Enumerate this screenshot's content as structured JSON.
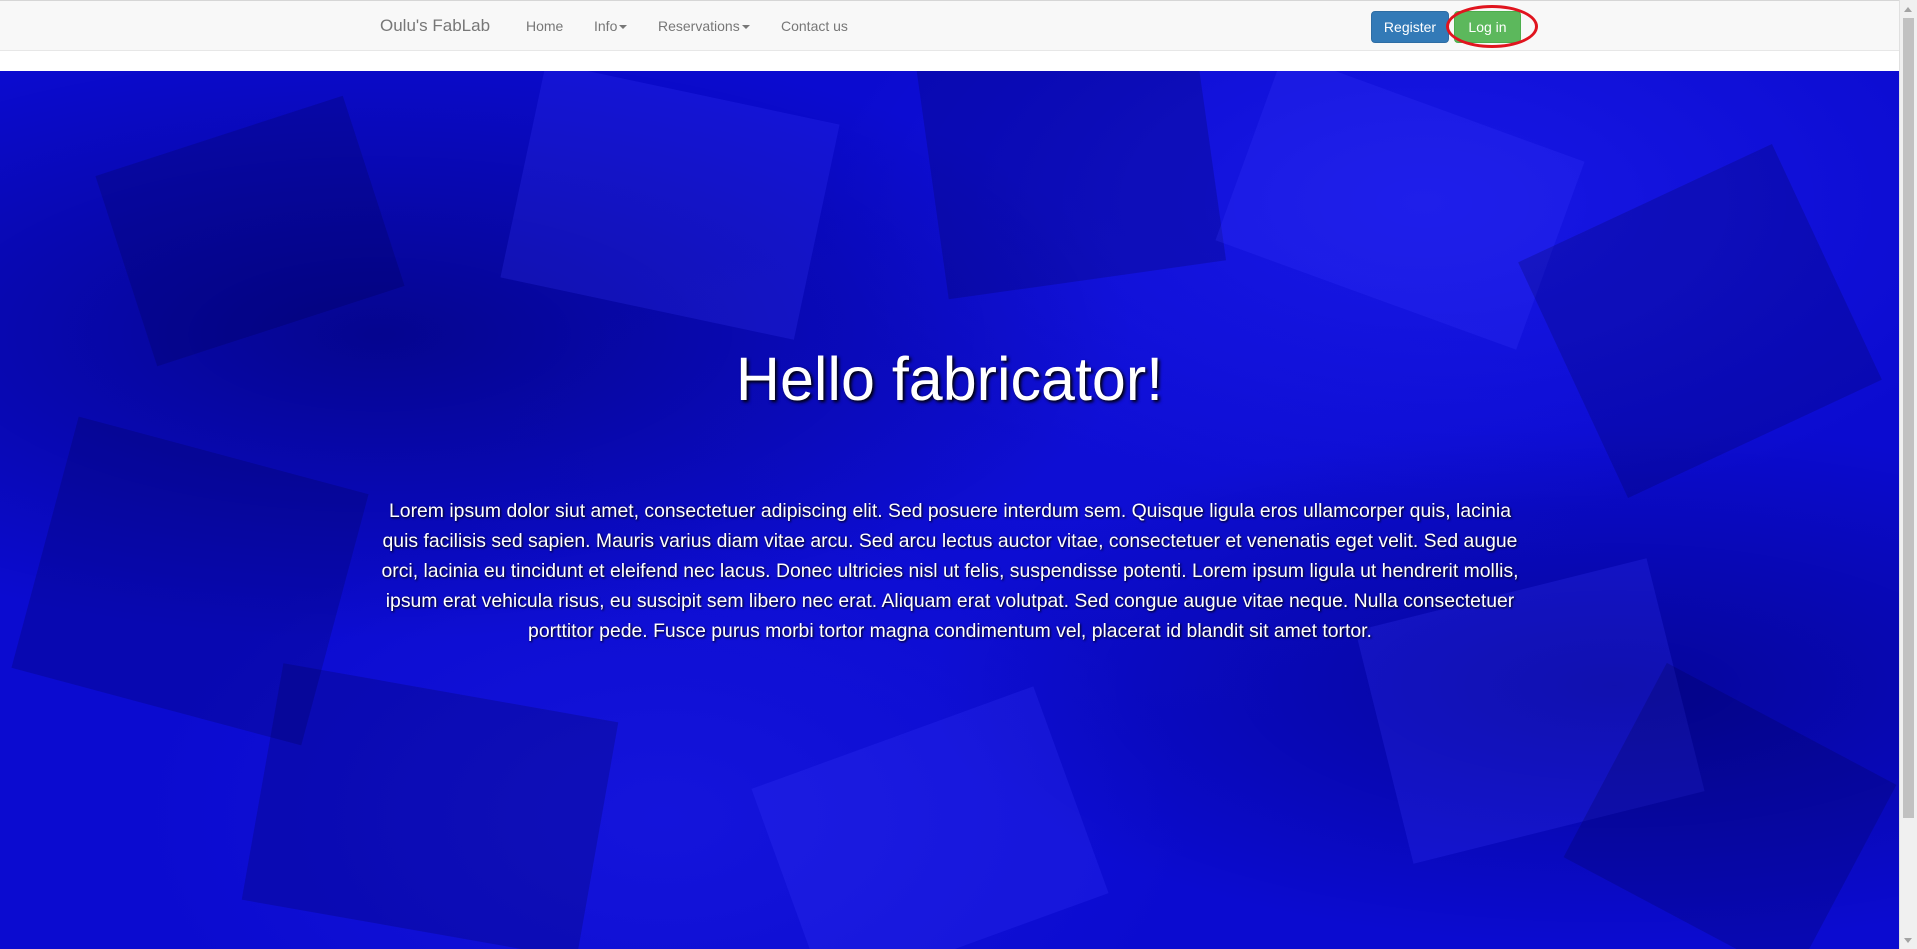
{
  "navbar": {
    "brand": "Oulu's FabLab",
    "links": [
      {
        "label": "Home",
        "dropdown": false
      },
      {
        "label": "Info",
        "dropdown": true
      },
      {
        "label": "Reservations",
        "dropdown": true
      },
      {
        "label": "Contact us",
        "dropdown": false
      }
    ],
    "register_label": "Register",
    "login_label": "Log in"
  },
  "hero": {
    "title": "Hello fabricator!",
    "text": "Lorem ipsum dolor siut amet, consectetuer adipiscing elit. Sed posuere interdum sem. Quisque ligula eros ullamcorper quis, lacinia quis facilisis sed sapien. Mauris varius diam vitae arcu. Sed arcu lectus auctor vitae, consectetuer et venenatis eget velit. Sed augue orci, lacinia eu tincidunt et eleifend nec lacus. Donec ultricies nisl ut felis, suspendisse potenti. Lorem ipsum ligula ut hendrerit mollis, ipsum erat vehicula risus, eu suscipit sem libero nec erat. Aliquam erat volutpat. Sed congue augue vitae neque. Nulla consectetuer porttitor pede. Fusce purus morbi tortor magna condimentum vel, placerat id blandit sit amet tortor."
  },
  "colors": {
    "hero_background": "#0b0bd0",
    "register_button": "#337ab7",
    "login_button": "#5cb85c",
    "annotation_highlight": "#e0141e"
  },
  "icons": {
    "dropdown": "caret-down-icon",
    "scroll_up": "arrow-up-icon",
    "scroll_down": "arrow-down-icon"
  }
}
